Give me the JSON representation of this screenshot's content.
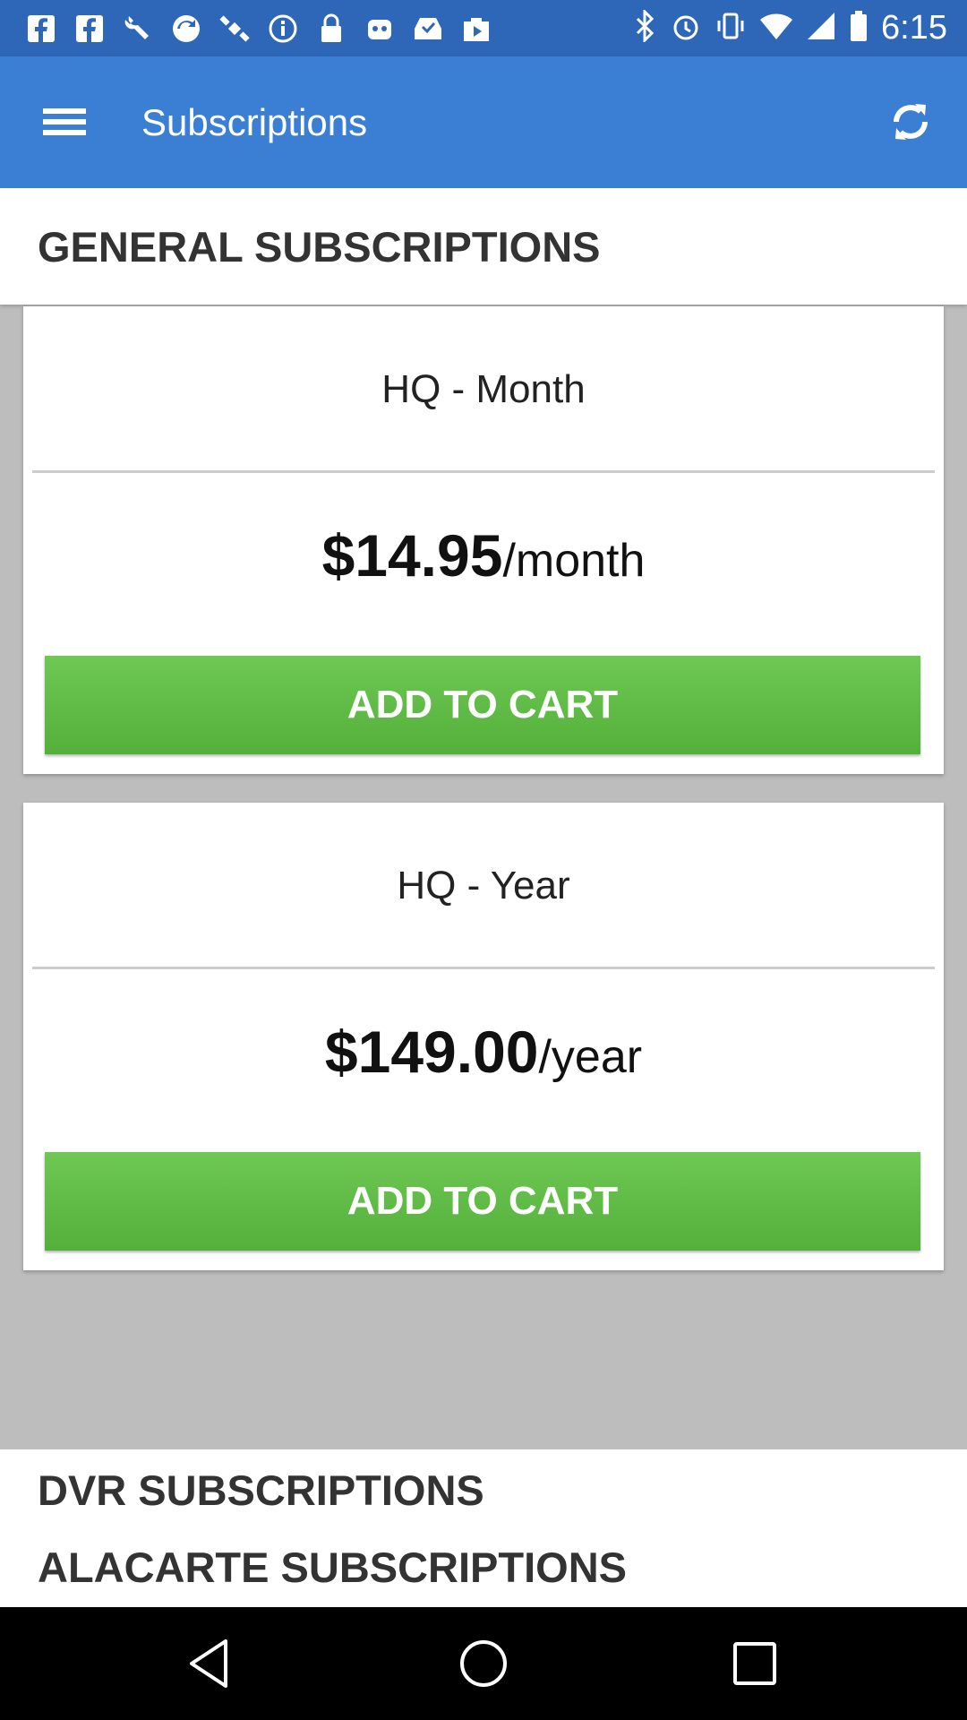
{
  "status_bar": {
    "time": "6:15",
    "left_icons": [
      "facebook-icon",
      "facebook-icon",
      "wrench-icon",
      "sync-icon",
      "satellite-icon",
      "info-icon",
      "lock-icon",
      "robot-icon",
      "inbox-icon",
      "play-store-icon"
    ],
    "right_icons": [
      "bluetooth-icon",
      "alarm-icon",
      "vibrate-icon",
      "wifi-icon",
      "signal-icon",
      "battery-icon"
    ]
  },
  "app_bar": {
    "title": "Subscriptions",
    "menu_icon": "menu-icon",
    "refresh_icon": "refresh-icon",
    "color": "#3b7fd4"
  },
  "general_section": {
    "title": "GENERAL SUBSCRIPTIONS",
    "plans": [
      {
        "name": "HQ - Month",
        "price": "$14.95",
        "period": "/month",
        "button": "ADD TO CART"
      },
      {
        "name": "HQ - Year",
        "price": "$149.00",
        "period": "/year",
        "button": "ADD TO CART"
      }
    ]
  },
  "other_sections": {
    "dvr": "DVR SUBSCRIPTIONS",
    "alacarte": "ALACARTE SUBSCRIPTIONS"
  },
  "colors": {
    "accent_green": "#5cb944",
    "status_blue": "#2e67b8"
  },
  "nav_bar": {
    "icons": [
      "back-icon",
      "home-icon",
      "recents-icon"
    ]
  }
}
